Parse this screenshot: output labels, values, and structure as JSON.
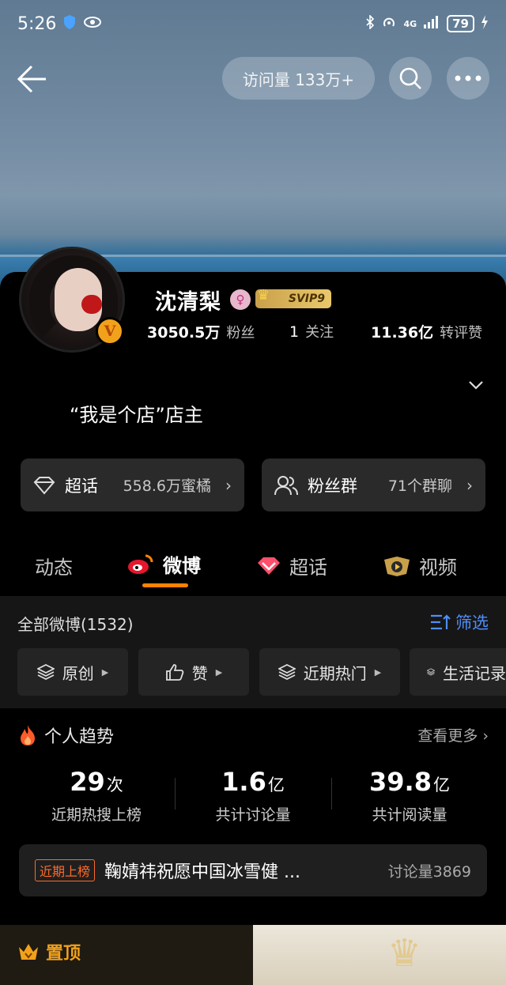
{
  "status_bar": {
    "time": "5:26",
    "battery": "79",
    "network": "4G"
  },
  "top_nav": {
    "visits_label": "访问量 133万+"
  },
  "profile": {
    "name": "沈清梨",
    "gender_symbol": "♀",
    "vip_badge": "SVIP9",
    "verified_mark": "V",
    "stats": [
      {
        "value": "3050.5万",
        "label": "粉丝"
      },
      {
        "value": "1",
        "label": "关注"
      },
      {
        "value": "11.36亿",
        "label": "转评赞"
      }
    ],
    "bio": "“我是个店”店主"
  },
  "pills": [
    {
      "label": "超话",
      "value": "558.6万蜜橘",
      "icon": "diamond-icon"
    },
    {
      "label": "粉丝群",
      "value": "71个群聊",
      "icon": "people-icon"
    }
  ],
  "tabs": [
    {
      "label": "动态"
    },
    {
      "label": "微博"
    },
    {
      "label": "超话"
    },
    {
      "label": "视频"
    }
  ],
  "feed": {
    "header": "全部微博(1532)",
    "filter_label": "筛选",
    "chips": [
      {
        "label": "原创"
      },
      {
        "label": "赞"
      },
      {
        "label": "近期热门"
      },
      {
        "label": "生活记录"
      }
    ]
  },
  "trend": {
    "title": "个人趋势",
    "more": "查看更多 ›",
    "metrics": [
      {
        "value": "29",
        "unit": "次",
        "label": "近期热搜上榜"
      },
      {
        "value": "1.6",
        "unit": "亿",
        "label": "共计讨论量"
      },
      {
        "value": "39.8",
        "unit": "亿",
        "label": "共计阅读量"
      }
    ],
    "hot": {
      "tag": "近期上榜",
      "topic": "鞠婧祎祝愿中国冰雪健 ...",
      "count": "讨论量3869"
    }
  },
  "pinned": {
    "label": "置顶"
  },
  "colors": {
    "accent_orange": "#ff8200",
    "link_blue": "#4f8ef7",
    "gold": "#f2a21a"
  }
}
